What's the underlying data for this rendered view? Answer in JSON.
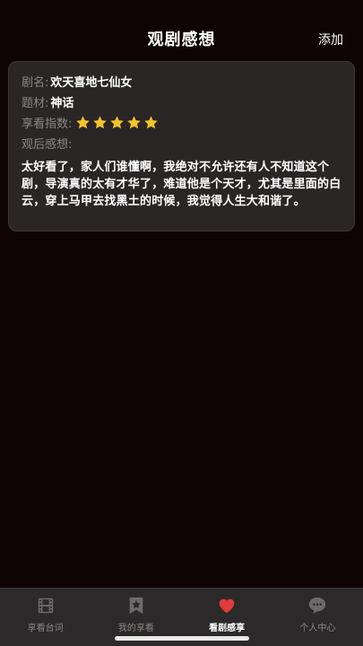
{
  "header": {
    "title": "观剧感想",
    "add_label": "添加"
  },
  "card": {
    "drama_label": "剧名:",
    "drama_value": "欢天喜地七仙女",
    "genre_label": "题材:",
    "genre_value": "神话",
    "rating_label": "享看指数:",
    "rating_stars": 5,
    "star_color": "#f5c22b",
    "comments_label": "观后感想:",
    "comments_text": "太好看了，家人们谁懂啊，我绝对不允许还有人不知道这个剧，导演真的太有才华了，难道他是个天才，尤其是里面的白云，穿上马甲去找黑土的时候，我觉得人生大和谐了。"
  },
  "tabbar": {
    "tabs": [
      {
        "label": "享看台词",
        "icon": "film-icon",
        "active": false
      },
      {
        "label": "我的享看",
        "icon": "bookmark-star-icon",
        "active": false
      },
      {
        "label": "看剧感享",
        "icon": "heart-icon",
        "active": true
      },
      {
        "label": "个人中心",
        "icon": "chat-bubble-icon",
        "active": false
      }
    ],
    "active_color": "#e23b3b",
    "inactive_color": "#6e6a6a"
  }
}
